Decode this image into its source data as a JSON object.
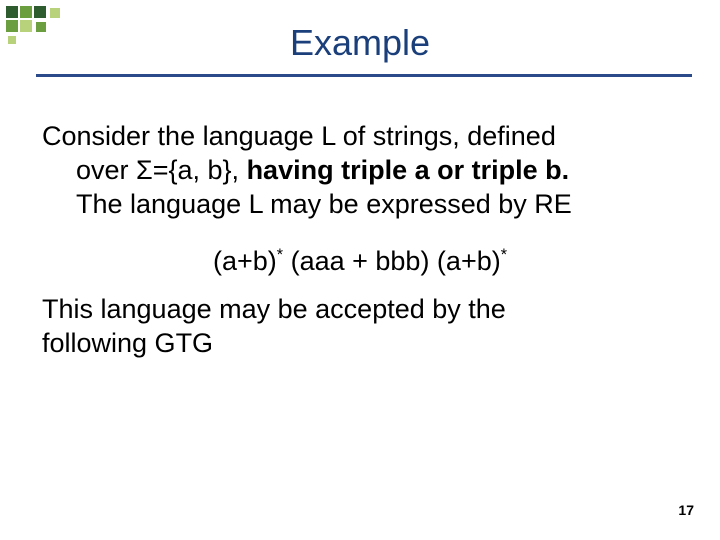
{
  "title": "Example",
  "body": {
    "p1_a": "Consider the language L of strings, defined",
    "p1_b_prefix": "over Σ={a, b}, ",
    "p1_b_bold": "having triple a or triple b.",
    "p1_c": "The language L may be expressed by RE",
    "re_before": "(a+b)",
    "re_sup1": "*",
    "re_mid": " (aaa + bbb) (a+b)",
    "re_sup2": "*",
    "p2_a": "This language may be accepted by the",
    "p2_b": "following GTG"
  },
  "page_number": "17"
}
